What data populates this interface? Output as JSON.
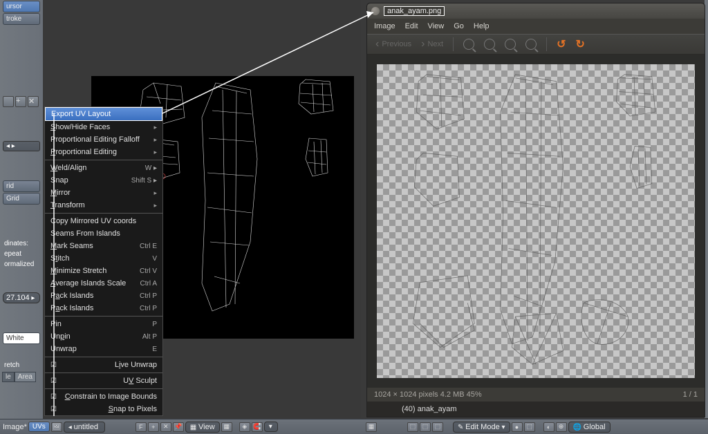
{
  "left_sidebar": {
    "cursor": "ursor",
    "stroke": "troke",
    "grid1": "rid",
    "grid2": "Grid",
    "dinates": "dinates:",
    "epeat": "epeat",
    "normalized": "ormalized",
    "coord_value": "27.104",
    "white": "White",
    "tab_stretch": "retch",
    "tab_angle": "le",
    "tab_area": "Area"
  },
  "uv_menu": {
    "items": [
      {
        "label": "Export UV Layout",
        "highlight": true
      },
      {
        "label": "Show/Hide Faces",
        "submenu": true,
        "u": 0
      },
      {
        "label": "Proportional Editing Falloff",
        "submenu": true
      },
      {
        "label": "Proportional Editing",
        "submenu": true,
        "u": 0
      },
      {
        "sep": true
      },
      {
        "label": "Weld/Align",
        "shortcut": "W",
        "submenu": true,
        "u": 0
      },
      {
        "label": "Snap",
        "shortcut": "Shift S",
        "submenu": true
      },
      {
        "label": "Mirror",
        "submenu": true,
        "u": 0
      },
      {
        "label": "Transform",
        "submenu": true,
        "u": 0
      },
      {
        "sep": true
      },
      {
        "label": "Copy Mirrored UV coords"
      },
      {
        "label": "Seams From Islands"
      },
      {
        "label": "Mark Seams",
        "u": 0
      },
      {
        "label": "Stitch",
        "shortcut": "Ctrl E"
      },
      {
        "label": "Minimize Stretch",
        "shortcut": "V"
      },
      {
        "label": "Average Islands Scale",
        "shortcut": "Ctrl V",
        "u": 0
      },
      {
        "label": "Pack Islands",
        "shortcut": "Ctrl A"
      },
      {
        "label": "",
        "shortcut": "Ctrl P",
        "real_label": "Pack Islands",
        "u": 1
      },
      {
        "sep": true
      },
      {
        "label": "Pin",
        "shortcut": "P"
      },
      {
        "label": "Unpin",
        "shortcut": "Alt P",
        "u": 2
      },
      {
        "label": "Unwrap",
        "shortcut": "E"
      },
      {
        "sep": true
      },
      {
        "label": "Live Unwrap",
        "checkbox": true,
        "u": 1
      },
      {
        "sep": true
      },
      {
        "label": "UV Sculpt",
        "checkbox": true,
        "u": 1
      },
      {
        "sep": true
      },
      {
        "label": "Constrain to Image Bounds",
        "checkbox": true,
        "u": 0
      },
      {
        "label": "Snap to Pixels",
        "checkbox": true,
        "u": 0
      }
    ]
  },
  "bottom_bar": {
    "image_label": "Image*",
    "uvs": "UVs",
    "untitled": "untitled",
    "view": "View"
  },
  "viewer": {
    "title": "anak_ayam.png",
    "menu": {
      "image": "Image",
      "edit": "Edit",
      "view": "View",
      "go": "Go",
      "help": "Help"
    },
    "toolbar": {
      "previous": "Previous",
      "next": "Next"
    },
    "status_left": "1024 × 1024 pixels  4.2 MB   45%",
    "status_right": "1 / 1",
    "footer": "(40) anak_ayam"
  },
  "bottom_right": {
    "edit_mode": "Edit Mode",
    "global": "Global"
  }
}
